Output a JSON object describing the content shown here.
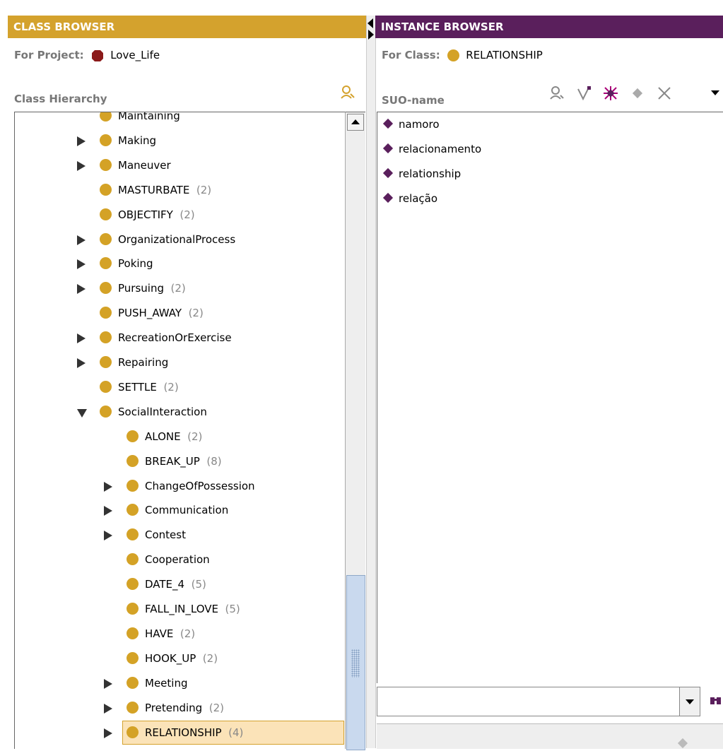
{
  "class_browser": {
    "title": "CLASS BROWSER",
    "project_label": "For Project:",
    "project_name": "Love_Life",
    "hierarchy_label": "Class Hierarchy",
    "tree": [
      {
        "label": "Maintaining",
        "count": "",
        "expander": "",
        "indent": 0
      },
      {
        "label": "Making",
        "count": "",
        "expander": "collapsed",
        "indent": 0
      },
      {
        "label": "Maneuver",
        "count": "",
        "expander": "collapsed",
        "indent": 0
      },
      {
        "label": "MASTURBATE",
        "count": "(2)",
        "expander": "",
        "indent": 0
      },
      {
        "label": "OBJECTIFY",
        "count": "(2)",
        "expander": "",
        "indent": 0
      },
      {
        "label": "OrganizationalProcess",
        "count": "",
        "expander": "collapsed",
        "indent": 0
      },
      {
        "label": "Poking",
        "count": "",
        "expander": "collapsed",
        "indent": 0
      },
      {
        "label": "Pursuing",
        "count": "(2)",
        "expander": "collapsed",
        "indent": 0
      },
      {
        "label": "PUSH_AWAY",
        "count": "(2)",
        "expander": "",
        "indent": 0
      },
      {
        "label": "RecreationOrExercise",
        "count": "",
        "expander": "collapsed",
        "indent": 0
      },
      {
        "label": "Repairing",
        "count": "",
        "expander": "collapsed",
        "indent": 0
      },
      {
        "label": "SETTLE",
        "count": "(2)",
        "expander": "",
        "indent": 0
      },
      {
        "label": "SocialInteraction",
        "count": "",
        "expander": "expanded",
        "indent": 0
      },
      {
        "label": "ALONE",
        "count": "(2)",
        "expander": "",
        "indent": 1
      },
      {
        "label": "BREAK_UP",
        "count": "(8)",
        "expander": "",
        "indent": 1
      },
      {
        "label": "ChangeOfPossession",
        "count": "",
        "expander": "collapsed",
        "indent": 1
      },
      {
        "label": "Communication",
        "count": "",
        "expander": "collapsed",
        "indent": 1
      },
      {
        "label": "Contest",
        "count": "",
        "expander": "collapsed",
        "indent": 1
      },
      {
        "label": "Cooperation",
        "count": "",
        "expander": "",
        "indent": 1
      },
      {
        "label": "DATE_4",
        "count": "(5)",
        "expander": "",
        "indent": 1
      },
      {
        "label": "FALL_IN_LOVE",
        "count": "(5)",
        "expander": "",
        "indent": 1
      },
      {
        "label": "HAVE",
        "count": "(2)",
        "expander": "",
        "indent": 1
      },
      {
        "label": "HOOK_UP",
        "count": "(2)",
        "expander": "",
        "indent": 1
      },
      {
        "label": "Meeting",
        "count": "",
        "expander": "collapsed",
        "indent": 1
      },
      {
        "label": "Pretending",
        "count": "(2)",
        "expander": "collapsed",
        "indent": 1
      },
      {
        "label": "RELATIONSHIP",
        "count": "(4)",
        "expander": "collapsed",
        "indent": 1,
        "selected": true
      }
    ]
  },
  "instance_browser": {
    "title": "INSTANCE BROWSER",
    "class_label": "For Class:",
    "class_name": "RELATIONSHIP",
    "column_label": "SUO-name",
    "instances": [
      "namoro",
      "relacionamento",
      "relationship",
      "relação"
    ],
    "search_value": ""
  },
  "colors": {
    "class_header": "#d4a22d",
    "instance_header": "#5a1f5c",
    "class_dot": "#d4a226",
    "project_icon": "#8b1a1a",
    "instance_diamond": "#5a1f5c",
    "selection_bg": "#fbe3b8",
    "scroll_thumb": "#c9d9ee"
  }
}
